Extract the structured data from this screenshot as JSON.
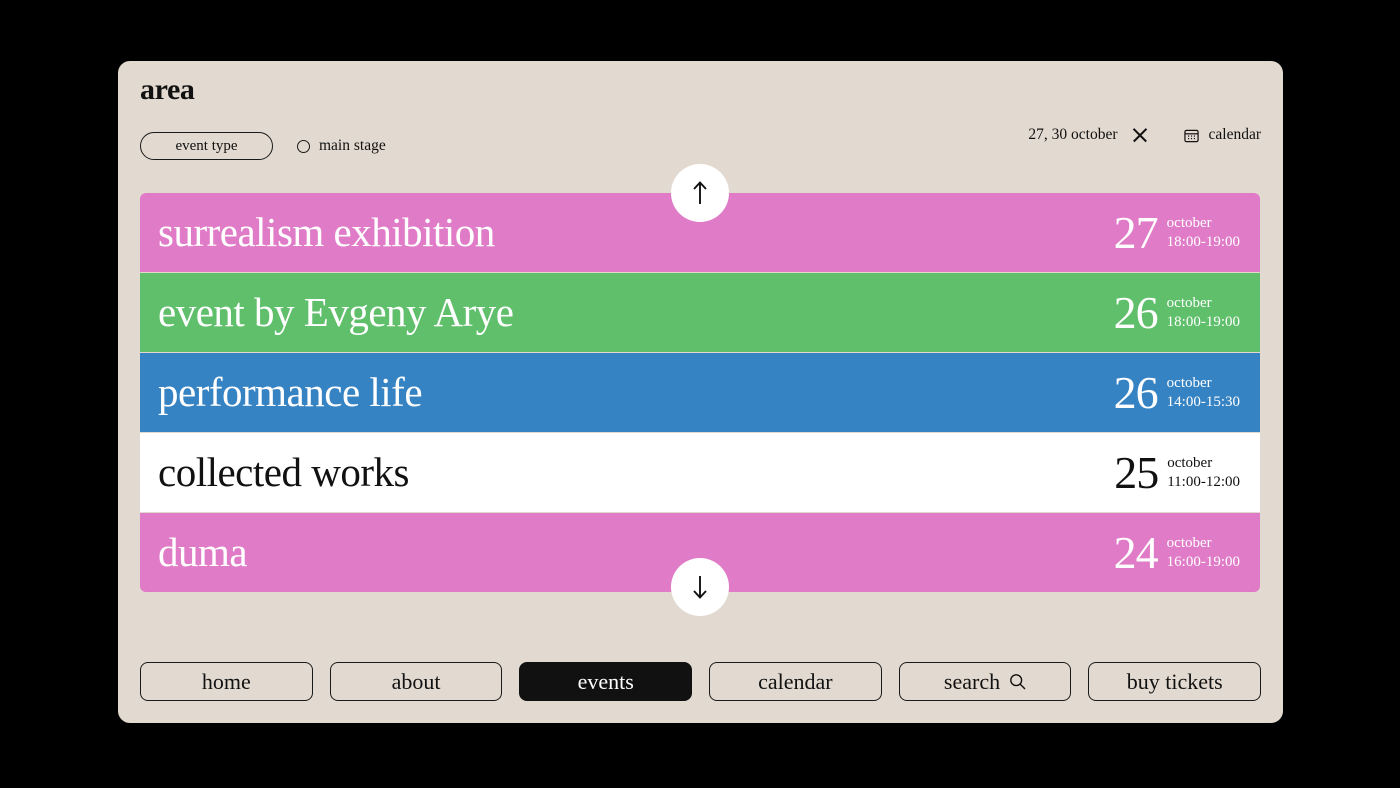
{
  "theme": {
    "canvas_bg": "#000000",
    "card_bg": "#E2DAD0",
    "ink": "#111111",
    "white": "#FFFFFF",
    "pink": "#E07CC7",
    "green": "#5FBF6B",
    "blue": "#3683C4"
  },
  "brand": {
    "name": "area"
  },
  "filters": {
    "event_type_label": "event type",
    "stage_label": "main stage",
    "stage_icon": "radio-circle-icon",
    "stage_selected": false
  },
  "toolbar": {
    "date_range": "27, 30 october",
    "clear_icon": "close-x-icon",
    "calendar_icon": "calendar-icon",
    "calendar_label": "calendar"
  },
  "scroll": {
    "up_icon": "arrow-up-icon",
    "down_icon": "arrow-down-icon"
  },
  "events": [
    {
      "title": "surrealism exhibition",
      "day": "27",
      "month": "october",
      "time": "18:00-19:00",
      "bg": "#E07CC7",
      "text_mode": "light"
    },
    {
      "title": "event by Evgeny Arye",
      "day": "26",
      "month": "october",
      "time": "18:00-19:00",
      "bg": "#5FBF6B",
      "text_mode": "light"
    },
    {
      "title": "performance life",
      "day": "26",
      "month": "october",
      "time": "14:00-15:30",
      "bg": "#3683C4",
      "text_mode": "light"
    },
    {
      "title": "collected works",
      "day": "25",
      "month": "october",
      "time": "11:00-12:00",
      "bg": "#FFFFFF",
      "text_mode": "dark"
    },
    {
      "title": "duma",
      "day": "24",
      "month": "october",
      "time": "16:00-19:00",
      "bg": "#E07CC7",
      "text_mode": "light"
    }
  ],
  "nav": [
    {
      "label": "home",
      "active": false,
      "icon": null
    },
    {
      "label": "about",
      "active": false,
      "icon": null
    },
    {
      "label": "events",
      "active": true,
      "icon": null
    },
    {
      "label": "calendar",
      "active": false,
      "icon": null
    },
    {
      "label": "search",
      "active": false,
      "icon": "search-icon"
    },
    {
      "label": "buy tickets",
      "active": false,
      "icon": null
    }
  ]
}
